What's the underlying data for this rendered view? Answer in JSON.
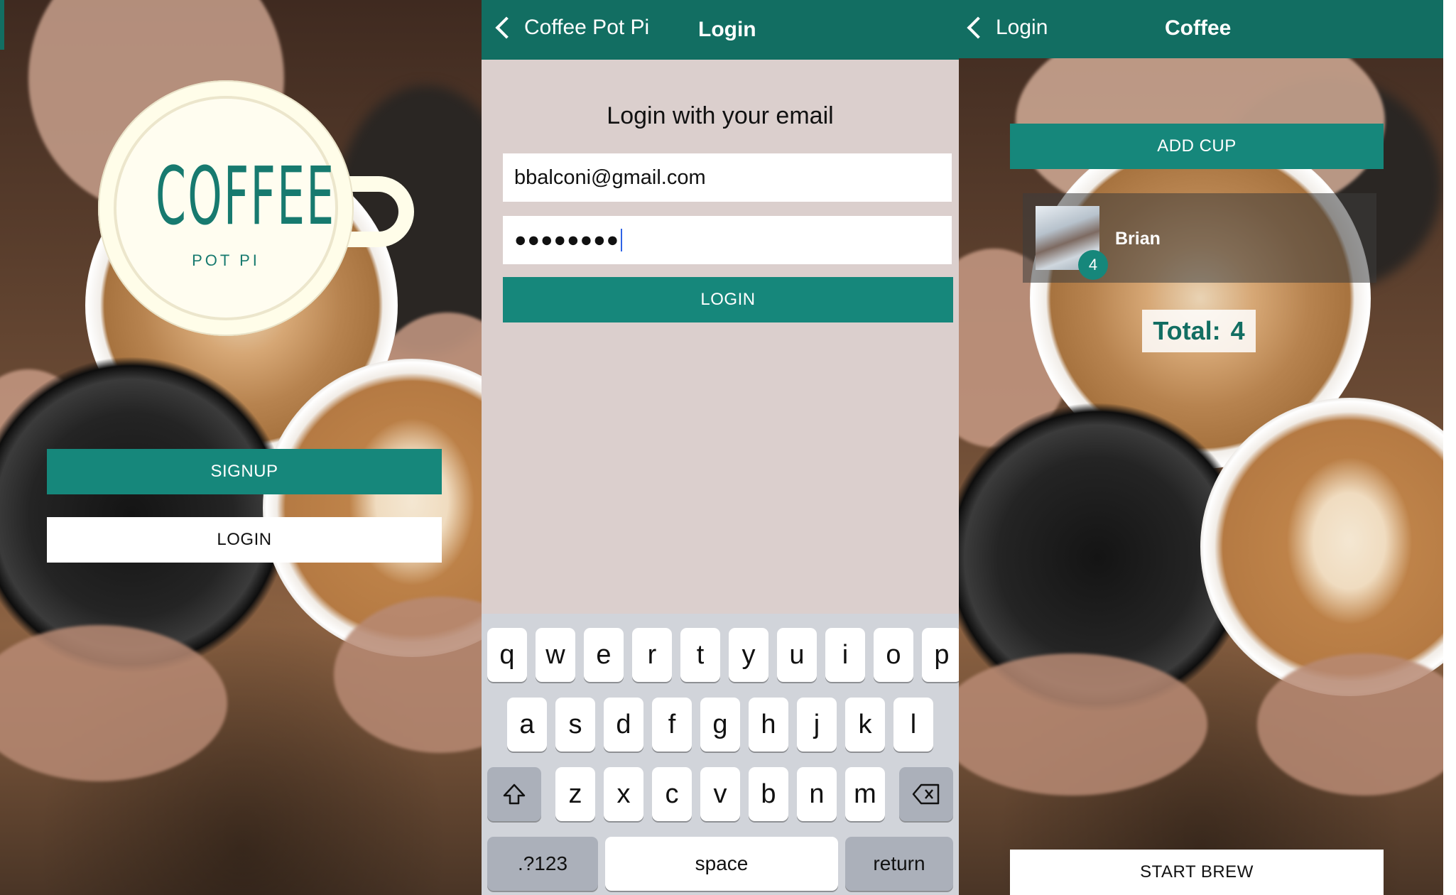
{
  "colors": {
    "teal": "#16877b",
    "navbar": "#126e62",
    "login_bg": "#dbcfcd"
  },
  "panel1": {
    "logo": {
      "title": "COFFEE",
      "subtitle": "POT PI"
    },
    "signup_label": "SIGNUP",
    "login_label": "LOGIN"
  },
  "panel2": {
    "nav": {
      "back_label": "Coffee Pot Pi",
      "title": "Login"
    },
    "heading": "Login with your email",
    "email_value": "bbalconi@gmail.com",
    "password_value": "●●●●●●●●",
    "login_label": "LOGIN",
    "keyboard": {
      "row1": [
        "q",
        "w",
        "e",
        "r",
        "t",
        "y",
        "u",
        "i",
        "o",
        "p"
      ],
      "row2": [
        "a",
        "s",
        "d",
        "f",
        "g",
        "h",
        "j",
        "k",
        "l"
      ],
      "row3": [
        "z",
        "x",
        "c",
        "v",
        "b",
        "n",
        "m"
      ],
      "numbers_label": ".?123",
      "space_label": "space",
      "return_label": "return",
      "shift_icon": "shift-icon",
      "backspace_icon": "backspace-icon"
    }
  },
  "panel3": {
    "nav": {
      "back_label": "Login",
      "title": "Coffee"
    },
    "add_cup_label": "ADD CUP",
    "user": {
      "name": "Brian",
      "count": "4"
    },
    "total_label": "Total:",
    "total_value": "4",
    "start_brew_label": "START BREW"
  }
}
